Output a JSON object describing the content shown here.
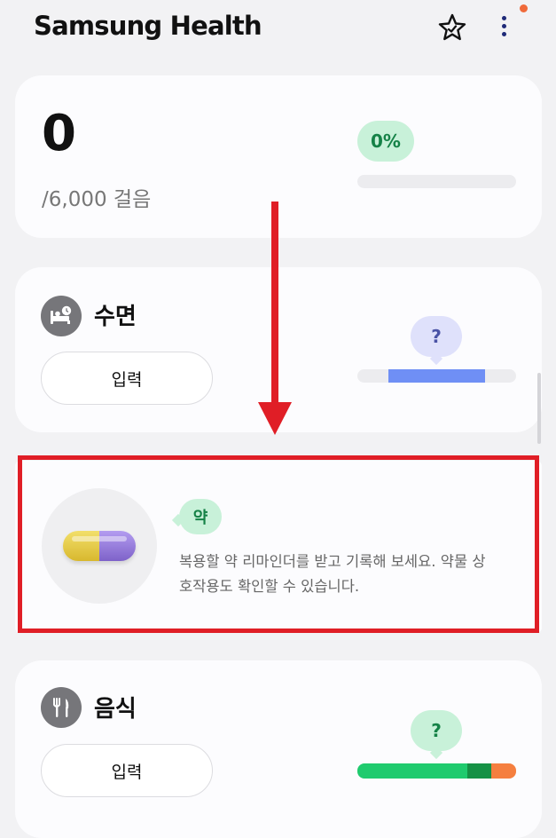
{
  "app": {
    "title": "Samsung Health"
  },
  "header": {
    "star_icon": "star-icon",
    "menu_icon": "more-vert-icon",
    "badge_color": "#f06a3a"
  },
  "steps": {
    "count": "0",
    "goal": "/6,000 걸음",
    "percent": "0%",
    "progress": 0
  },
  "sleep": {
    "title": "수면",
    "input_label": "입력",
    "status": "?",
    "icon": "bed-icon",
    "bar_fill_color": "#6f8ff5"
  },
  "medication": {
    "badge": "약",
    "description": "복용할 약 리마인더를 받고 기록해 보세요. 약물 상호작용도 확인할 수 있습니다.",
    "icon": "pill-icon"
  },
  "food": {
    "title": "음식",
    "input_label": "입력",
    "status": "?",
    "icon": "fork-knife-icon",
    "bar_colors": [
      "#1fcb6e",
      "#159145",
      "#f57f3f"
    ]
  },
  "annotation": {
    "highlight_color": "#e01e26",
    "arrow_color": "#e01e26"
  }
}
